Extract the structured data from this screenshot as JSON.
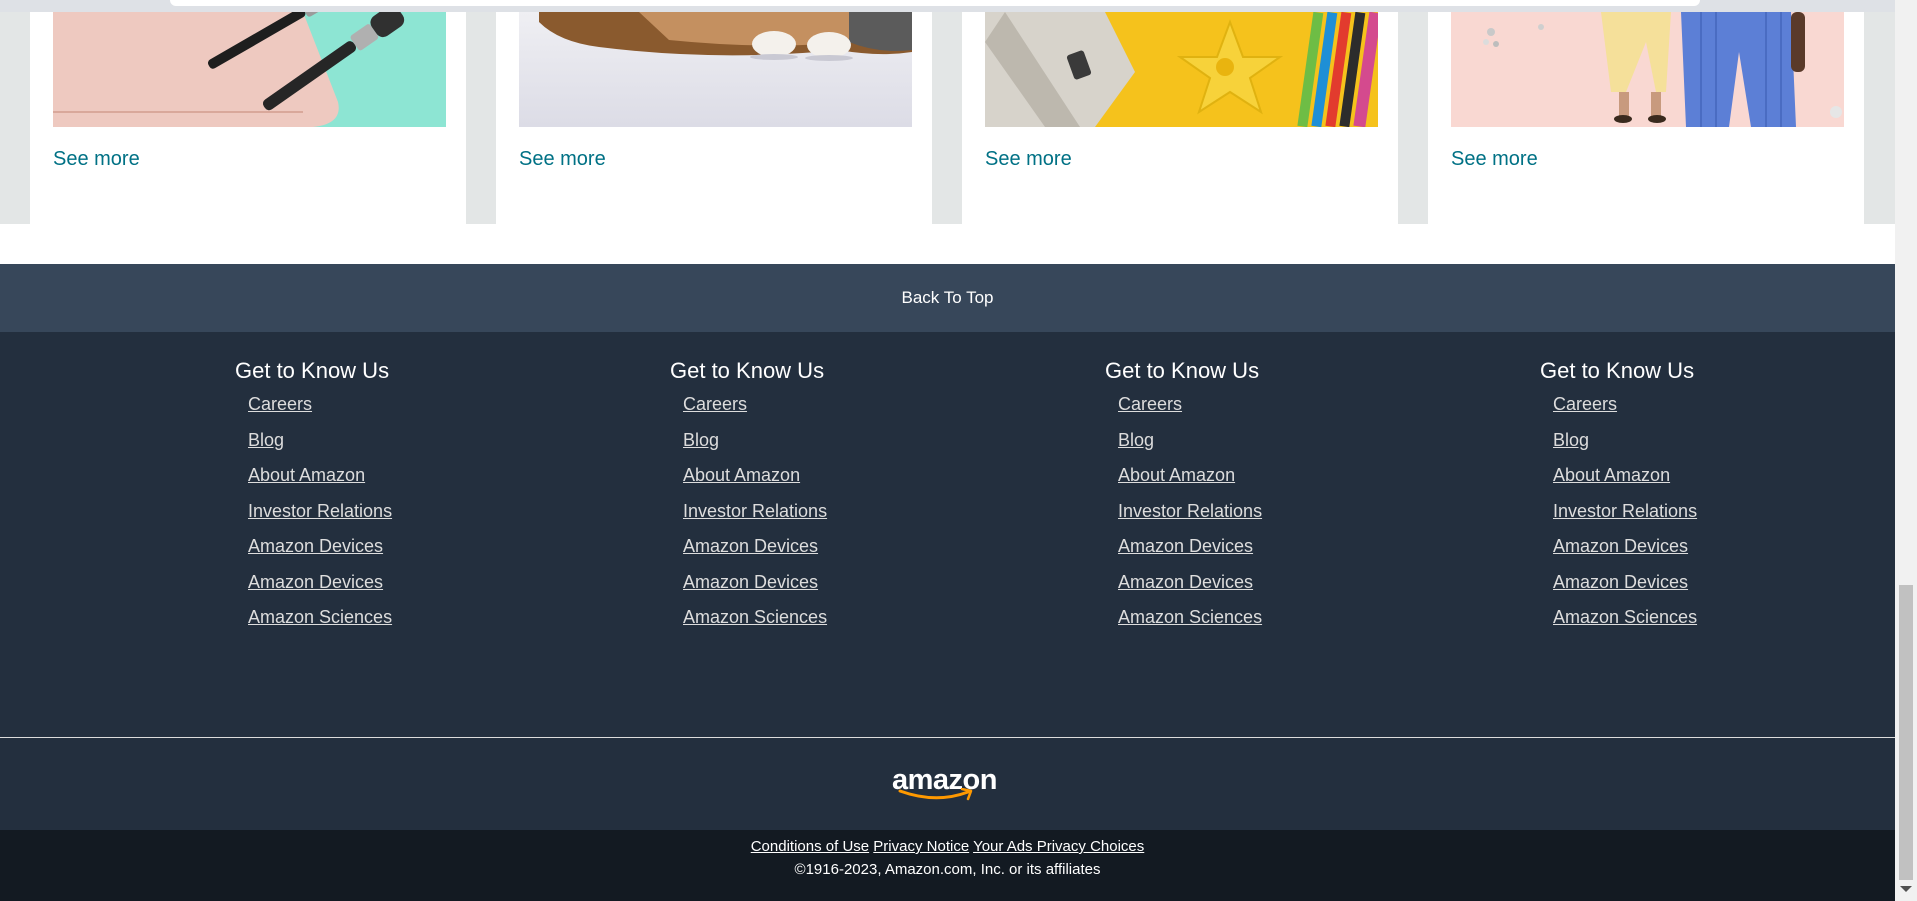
{
  "cards": [
    {
      "see_more": "See more",
      "image": "makeup-brushes-pink-pouch"
    },
    {
      "see_more": "See more",
      "image": "pet-paws-on-floor"
    },
    {
      "see_more": "See more",
      "image": "toys-and-colored-pencils"
    },
    {
      "see_more": "See more",
      "image": "fashion-outfits"
    }
  ],
  "back_to_top": "Back To Top",
  "footer_columns": [
    {
      "heading": "Get to Know Us",
      "links": [
        "Careers",
        "Blog",
        "About Amazon",
        "Investor Relations",
        "Amazon Devices",
        "Amazon Devices",
        "Amazon Sciences"
      ]
    },
    {
      "heading": "Get to Know Us",
      "links": [
        "Careers",
        "Blog",
        "About Amazon",
        "Investor Relations",
        "Amazon Devices",
        "Amazon Devices",
        "Amazon Sciences"
      ]
    },
    {
      "heading": "Get to Know Us",
      "links": [
        "Careers",
        "Blog",
        "About Amazon",
        "Investor Relations",
        "Amazon Devices",
        "Amazon Devices",
        "Amazon Sciences"
      ]
    },
    {
      "heading": "Get to Know Us",
      "links": [
        "Careers",
        "Blog",
        "About Amazon",
        "Investor Relations",
        "Amazon Devices",
        "Amazon Devices",
        "Amazon Sciences"
      ]
    }
  ],
  "logo": {
    "wordmark": "amazon",
    "icon": "amazon-smile-arrow"
  },
  "legal": {
    "conditions": "Conditions of Use",
    "privacy": "Privacy Notice",
    "ads": "Your Ads Privacy Choices",
    "copyright": "©1916-2023, Amazon.com, Inc. or its affiliates"
  },
  "colors": {
    "link_teal": "#007185",
    "back_to_top_bg": "#37475a",
    "footer_bg": "#232f3e",
    "bottom_bg": "#131a22",
    "logo_arrow": "#ff9900"
  }
}
